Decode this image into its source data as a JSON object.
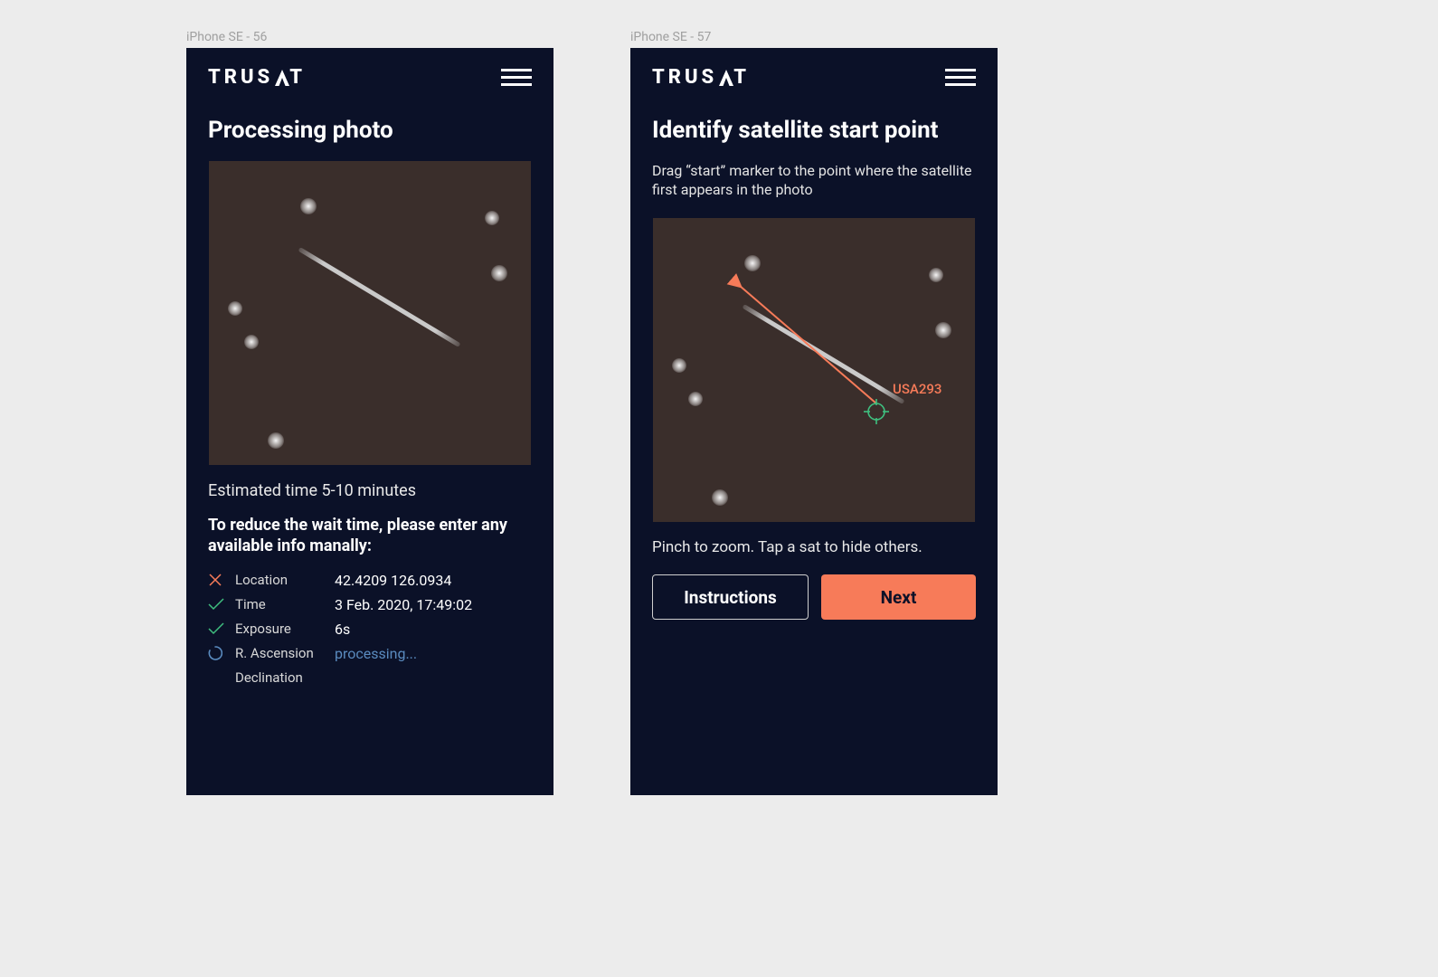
{
  "frames": {
    "left_label": "iPhone SE - 56",
    "right_label": "iPhone SE - 57"
  },
  "brand": "TRUSAT",
  "left": {
    "title": "Processing photo",
    "estimate": "Estimated time 5-10 minutes",
    "prompt": "To reduce the wait time, please enter any available info manally:",
    "rows": {
      "location_label": "Location",
      "location_value": "42.4209 126.0934",
      "time_label": "Time",
      "time_value": "3 Feb. 2020, 17:49:02",
      "exposure_label": "Exposure",
      "exposure_value": "6s",
      "ra_label": "R. Ascension",
      "ra_value": "processing...",
      "dec_label": "Declination",
      "dec_value": ""
    }
  },
  "right": {
    "title": "Identify satellite start point",
    "subtitle": "Drag “start” marker to the point where the satellite first appears in the photo",
    "sat_name": "USA293",
    "hint": "Pinch to zoom. Tap a sat to hide others.",
    "instructions_label": "Instructions",
    "next_label": "Next"
  },
  "colors": {
    "accent": "#F77B59",
    "link": "#5A8BBF",
    "bg": "#0B1128",
    "sky": "#3A2E2B",
    "success": "#3FBF7F",
    "error": "#F77B59"
  }
}
